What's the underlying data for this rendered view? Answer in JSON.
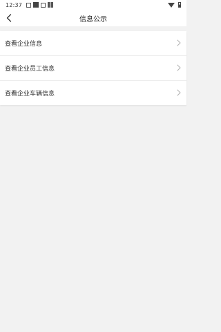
{
  "status_bar": {
    "time": "12:37",
    "icons": [
      "image-icon",
      "square-icon",
      "a-icon",
      "grid-icon"
    ],
    "right_icons": [
      "wifi-icon",
      "battery-icon"
    ]
  },
  "header": {
    "title": "信息公示",
    "back_icon": "back-icon"
  },
  "menu": {
    "items": [
      {
        "label": "查看企业信息"
      },
      {
        "label": "查看企业员工信息"
      },
      {
        "label": "查看企业车辆信息"
      }
    ]
  },
  "colors": {
    "background": "#f2f2f2",
    "card": "#ffffff",
    "text": "#333333",
    "chevron": "#b0b0b0"
  }
}
